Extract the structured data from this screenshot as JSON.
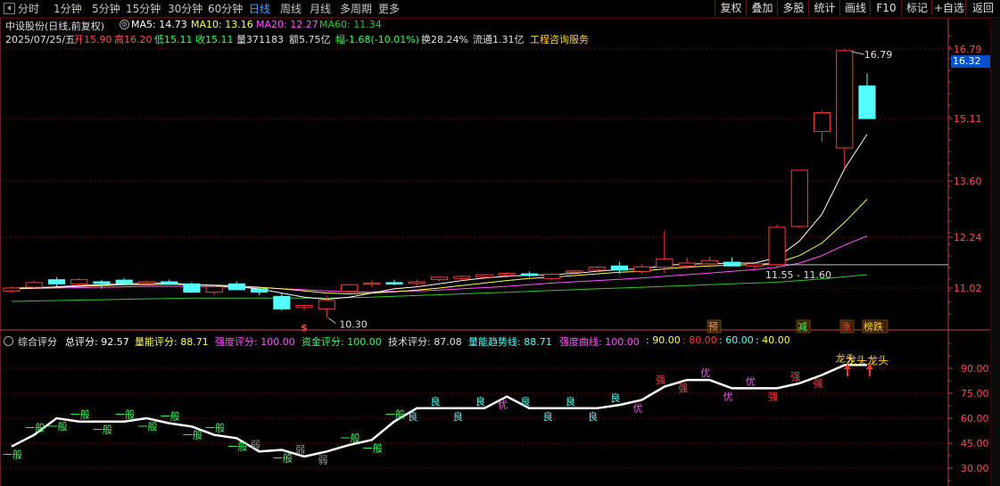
{
  "toolbar": {
    "tabs": [
      "分时",
      "1分钟",
      "5分钟",
      "15分钟",
      "30分钟",
      "60分钟",
      "日线",
      "周线",
      "月线",
      "多周期",
      "更多"
    ],
    "active_tab": "日线",
    "right_buttons": [
      "复权",
      "叠加",
      "多股",
      "统计",
      "画线",
      "F10",
      "标记",
      "+自选",
      "返回"
    ]
  },
  "header": {
    "stock_title": "中设股份(日线,前复权)",
    "ma5": "MA5: 14.73",
    "ma10": "MA10: 13.16",
    "ma20": "MA20: 12.27",
    "ma60": "MA60: 11.34",
    "date": "2025/07/25/五",
    "open": "开15.90",
    "high": "高16.20",
    "low": "低15.11",
    "close": "收15.11",
    "volume": "量371183",
    "amount": "额5.75亿",
    "change": "幅-1.68(-10.01%)",
    "turnover": "换28.24%",
    "float": "流通1.31亿",
    "industry": "工程咨询服务"
  },
  "colors": {
    "up": "#ff3b3b",
    "down": "#54ffff",
    "ma5": "#ffffff",
    "ma10": "#ffff54",
    "ma20": "#ff54ff",
    "ma60": "#2ec72e",
    "grid": "#7a0000",
    "axis": "#c84040",
    "active_tab": "#4aa3ff",
    "price_tag": "#0052cc"
  },
  "price_axis": {
    "ticks": [
      "16.79",
      "15.11",
      "13.60",
      "12.24",
      "11.02"
    ],
    "current_price_tag": "16.32"
  },
  "price_annotations": {
    "high_label": "16.79",
    "low_label": "10.30",
    "range_label": "11.55 - 11.60",
    "dollar_marker": "$"
  },
  "signal_badges": [
    {
      "name": "badge-yu",
      "text": "预",
      "color": "#ff9a3c"
    },
    {
      "name": "badge-jian",
      "text": "减",
      "color": "#3cff5a"
    },
    {
      "name": "badge-zhang",
      "text": "涨",
      "color": "#ff4040"
    },
    {
      "name": "badge-bangdie",
      "text": "榜跌",
      "color": "#ffd23c"
    }
  ],
  "indicator": {
    "title": "综合评分",
    "total": "总评分: 92.57",
    "volume_score": "量能评分: 88.71",
    "strength_score": "强度评分: 100.00",
    "capital_score": "资金评分: 100.00",
    "tech_score": "技术评分: 87.08",
    "volume_trend": "量能趋势线: 88.71",
    "strength_curve": "强度曲线: 100.00",
    "level_90": ": 90.00",
    "level_80": ": 80.00",
    "level_60": ": 60.00",
    "level_40": ": 40.00",
    "axis_ticks": [
      "90.00",
      "75.00",
      "60.00",
      "45.00",
      "30.00"
    ],
    "dragon_label": "龙头龙头",
    "level_colors": {
      "strength_curve": "#ff54ff",
      "level_90": "#ffff54",
      "level_80": "#ff3b3b",
      "level_60": "#54ffff",
      "level_40": "#ffff54"
    }
  },
  "score_curve": {
    "values": [
      43,
      50,
      60,
      58,
      58,
      58,
      60,
      57,
      55,
      50,
      48,
      40,
      41,
      37,
      40,
      44,
      47,
      58,
      66,
      66,
      66,
      66,
      73,
      66,
      66,
      66,
      66,
      68,
      71,
      79,
      83,
      83,
      78,
      78,
      78,
      81,
      86,
      92,
      92
    ],
    "labels": [
      "一般",
      "一般",
      "一般",
      "一般",
      "一般",
      "一般",
      "一般",
      "一般",
      "一般",
      "一般",
      "一般",
      "弱",
      "一般",
      "弱",
      "弱",
      "一般",
      "一般",
      "一般",
      "良",
      "良",
      "良",
      "良",
      "优",
      "良",
      "良",
      "良",
      "良",
      "良",
      "优",
      "强",
      "强",
      "优",
      "优",
      "优",
      "强",
      "强",
      "强",
      "龙头",
      ""
    ]
  },
  "chart_data": {
    "type": "candlestick",
    "date_of_last_bar": "2025/07/25",
    "ohlc": [
      {
        "o": 10.95,
        "h": 11.06,
        "l": 10.9,
        "c": 11.02
      },
      {
        "o": 11.04,
        "h": 11.2,
        "l": 11.0,
        "c": 11.15
      },
      {
        "o": 11.22,
        "h": 11.28,
        "l": 11.05,
        "c": 11.12
      },
      {
        "o": 11.12,
        "h": 11.26,
        "l": 11.08,
        "c": 11.22
      },
      {
        "o": 11.17,
        "h": 11.22,
        "l": 11.0,
        "c": 11.13
      },
      {
        "o": 11.21,
        "h": 11.26,
        "l": 11.08,
        "c": 11.13
      },
      {
        "o": 11.13,
        "h": 11.2,
        "l": 11.05,
        "c": 11.17
      },
      {
        "o": 11.17,
        "h": 11.22,
        "l": 11.1,
        "c": 11.12
      },
      {
        "o": 11.12,
        "h": 11.16,
        "l": 10.9,
        "c": 10.92
      },
      {
        "o": 10.92,
        "h": 11.1,
        "l": 10.85,
        "c": 11.05
      },
      {
        "o": 11.12,
        "h": 11.18,
        "l": 10.98,
        "c": 10.98
      },
      {
        "o": 11.0,
        "h": 11.05,
        "l": 10.85,
        "c": 10.92
      },
      {
        "o": 10.82,
        "h": 10.9,
        "l": 10.48,
        "c": 10.52
      },
      {
        "o": 10.55,
        "h": 10.62,
        "l": 10.48,
        "c": 10.6
      },
      {
        "o": 10.52,
        "h": 10.82,
        "l": 10.3,
        "c": 10.72
      },
      {
        "o": 10.94,
        "h": 11.12,
        "l": 10.88,
        "c": 11.1
      },
      {
        "o": 11.12,
        "h": 11.2,
        "l": 11.05,
        "c": 11.14
      },
      {
        "o": 11.15,
        "h": 11.22,
        "l": 11.08,
        "c": 11.13
      },
      {
        "o": 11.13,
        "h": 11.22,
        "l": 11.06,
        "c": 11.17
      },
      {
        "o": 11.22,
        "h": 11.3,
        "l": 11.18,
        "c": 11.28
      },
      {
        "o": 11.25,
        "h": 11.32,
        "l": 11.2,
        "c": 11.3
      },
      {
        "o": 11.28,
        "h": 11.36,
        "l": 11.22,
        "c": 11.34
      },
      {
        "o": 11.32,
        "h": 11.4,
        "l": 11.26,
        "c": 11.37
      },
      {
        "o": 11.36,
        "h": 11.42,
        "l": 11.28,
        "c": 11.32
      },
      {
        "o": 11.25,
        "h": 11.38,
        "l": 11.2,
        "c": 11.35
      },
      {
        "o": 11.4,
        "h": 11.46,
        "l": 11.35,
        "c": 11.43
      },
      {
        "o": 11.45,
        "h": 11.55,
        "l": 11.4,
        "c": 11.52
      },
      {
        "o": 11.55,
        "h": 11.65,
        "l": 11.36,
        "c": 11.45
      },
      {
        "o": 11.42,
        "h": 11.58,
        "l": 11.36,
        "c": 11.53
      },
      {
        "o": 11.52,
        "h": 12.4,
        "l": 11.38,
        "c": 11.72
      },
      {
        "o": 11.55,
        "h": 11.75,
        "l": 11.48,
        "c": 11.62
      },
      {
        "o": 11.6,
        "h": 11.78,
        "l": 11.5,
        "c": 11.68
      },
      {
        "o": 11.64,
        "h": 11.76,
        "l": 11.55,
        "c": 11.55
      },
      {
        "o": 11.55,
        "h": 11.62,
        "l": 11.48,
        "c": 11.6
      },
      {
        "o": 11.58,
        "h": 12.55,
        "l": 11.5,
        "c": 12.48
      },
      {
        "o": 12.5,
        "h": 13.86,
        "l": 12.46,
        "c": 13.86
      },
      {
        "o": 14.8,
        "h": 15.3,
        "l": 14.55,
        "c": 15.25
      },
      {
        "o": 14.4,
        "h": 16.79,
        "l": 13.9,
        "c": 16.75
      },
      {
        "o": 15.9,
        "h": 16.2,
        "l": 15.11,
        "c": 15.11
      }
    ],
    "ma5": [
      11.0,
      11.02,
      11.05,
      11.08,
      11.1,
      11.12,
      11.13,
      11.14,
      11.1,
      11.08,
      11.05,
      11.0,
      10.9,
      10.8,
      10.75,
      10.8,
      10.9,
      11.0,
      11.05,
      11.12,
      11.2,
      11.26,
      11.3,
      11.33,
      11.34,
      11.37,
      11.42,
      11.46,
      11.48,
      11.56,
      11.6,
      11.6,
      11.62,
      11.62,
      11.75,
      12.15,
      12.8,
      13.9,
      14.73
    ],
    "ma10": [
      11.02,
      11.03,
      11.04,
      11.06,
      11.08,
      11.1,
      11.1,
      11.11,
      11.1,
      11.09,
      11.07,
      11.04,
      11.0,
      10.95,
      10.9,
      10.88,
      10.9,
      10.93,
      10.97,
      11.02,
      11.08,
      11.14,
      11.2,
      11.25,
      11.28,
      11.32,
      11.36,
      11.4,
      11.42,
      11.48,
      11.52,
      11.55,
      11.57,
      11.58,
      11.62,
      11.8,
      12.1,
      12.6,
      13.16
    ],
    "ma20": [
      11.0,
      11.01,
      11.02,
      11.03,
      11.04,
      11.05,
      11.06,
      11.06,
      11.06,
      11.05,
      11.04,
      11.03,
      11.0,
      10.98,
      10.95,
      10.93,
      10.93,
      10.94,
      10.95,
      10.97,
      11.0,
      11.03,
      11.06,
      11.1,
      11.14,
      11.17,
      11.2,
      11.23,
      11.26,
      11.3,
      11.34,
      11.38,
      11.42,
      11.46,
      11.52,
      11.62,
      11.8,
      12.05,
      12.27
    ],
    "ma60": [
      10.7,
      10.71,
      10.72,
      10.73,
      10.74,
      10.75,
      10.76,
      10.77,
      10.78,
      10.78,
      10.78,
      10.78,
      10.78,
      10.78,
      10.78,
      10.79,
      10.8,
      10.82,
      10.84,
      10.86,
      10.88,
      10.9,
      10.92,
      10.94,
      10.96,
      10.98,
      11.0,
      11.02,
      11.04,
      11.06,
      11.08,
      11.1,
      11.12,
      11.14,
      11.16,
      11.2,
      11.24,
      11.29,
      11.34
    ],
    "reference_line": 11.58,
    "ylim": [
      10.0,
      17.0
    ]
  }
}
